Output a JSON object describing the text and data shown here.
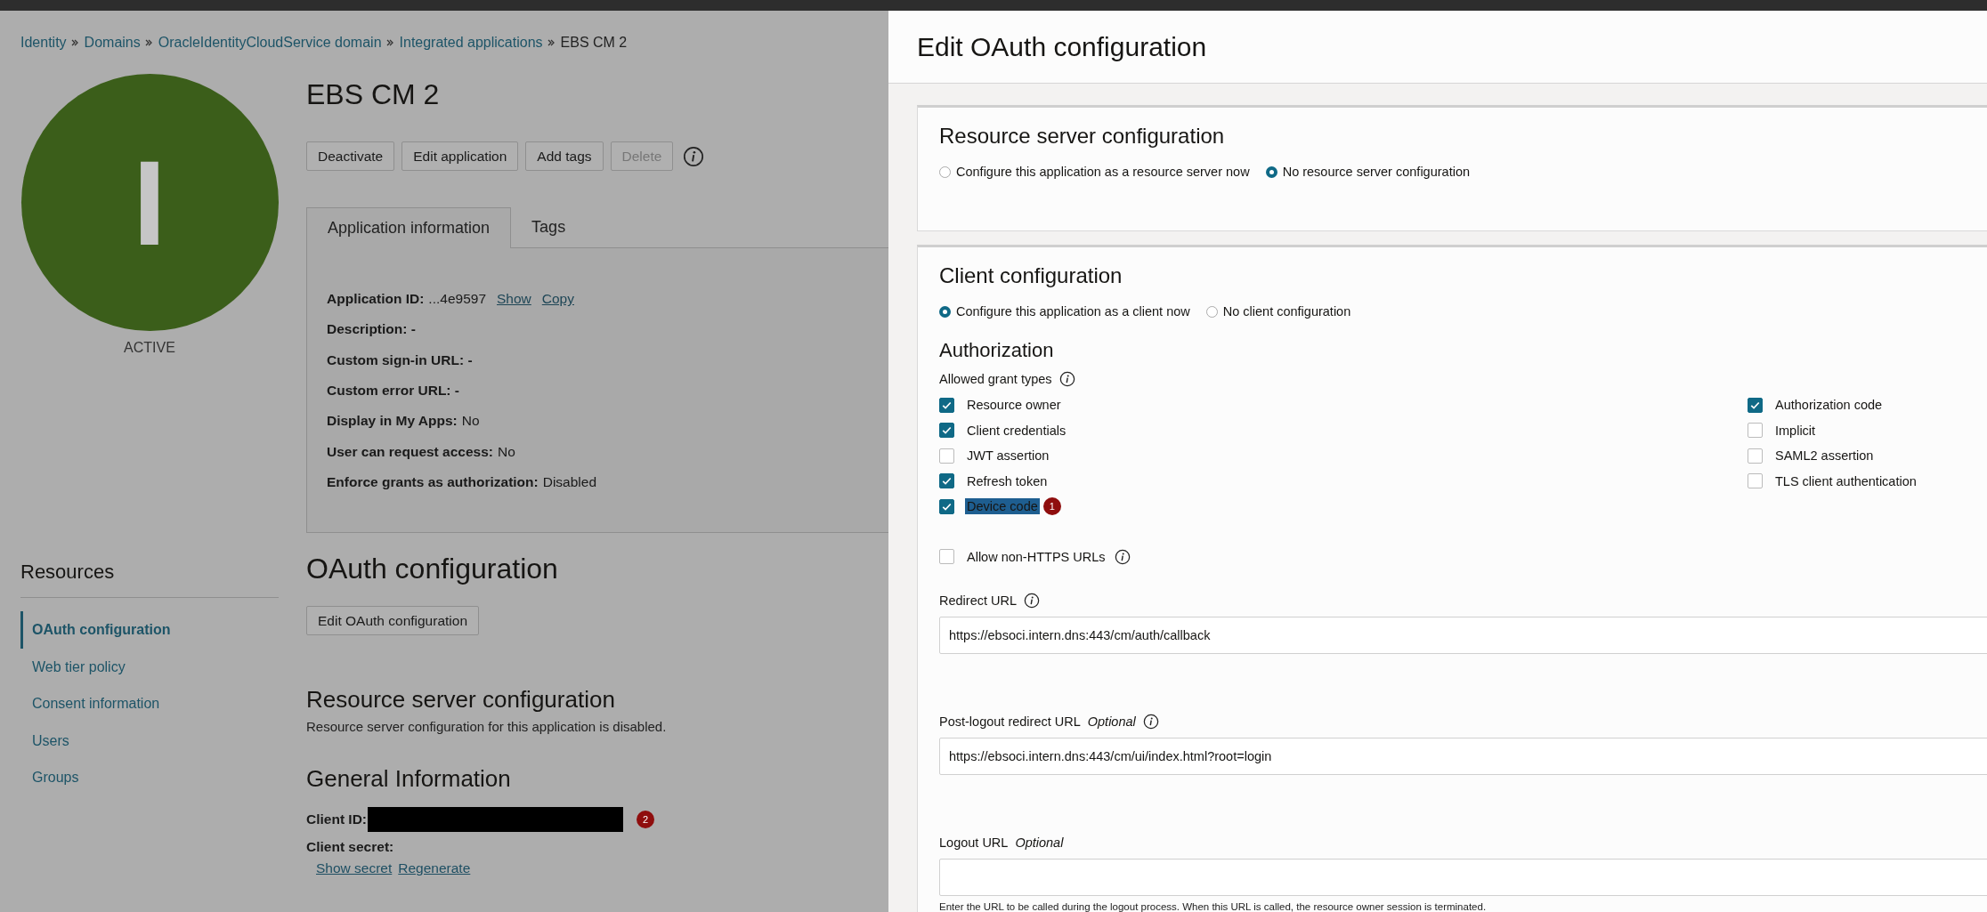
{
  "breadcrumb": [
    {
      "label": "Identity",
      "link": true
    },
    {
      "label": "Domains",
      "link": true
    },
    {
      "label": "OracleIdentityCloudService domain",
      "link": true
    },
    {
      "label": "Integrated applications",
      "link": true
    },
    {
      "label": "EBS CM 2",
      "link": false
    }
  ],
  "app": {
    "initial": "I",
    "status": "ACTIVE",
    "title": "EBS CM 2"
  },
  "actions": [
    {
      "label": "Deactivate",
      "disabled": false
    },
    {
      "label": "Edit application",
      "disabled": false
    },
    {
      "label": "Add tags",
      "disabled": false
    },
    {
      "label": "Delete",
      "disabled": true
    }
  ],
  "tabs": [
    {
      "label": "Application information",
      "selected": true
    },
    {
      "label": "Tags",
      "selected": false
    }
  ],
  "app_info": [
    {
      "label": "Application ID:",
      "value": "...4e9597",
      "links": [
        "Show",
        "Copy"
      ]
    },
    {
      "label": "Description: -"
    },
    {
      "label": "Custom sign-in URL: -"
    },
    {
      "label": "Custom error URL: -"
    },
    {
      "label": "Display in My Apps:",
      "value": "No"
    },
    {
      "label": "User can request access:",
      "value": "No"
    },
    {
      "label": "Enforce grants as authorization:",
      "value": "Disabled"
    }
  ],
  "resources": {
    "title": "Resources",
    "items": [
      {
        "label": "OAuth configuration",
        "selected": true
      },
      {
        "label": "Web tier policy",
        "selected": false
      },
      {
        "label": "Consent information",
        "selected": false
      },
      {
        "label": "Users",
        "selected": false
      },
      {
        "label": "Groups",
        "selected": false
      }
    ]
  },
  "oauth": {
    "title": "OAuth configuration",
    "edit_button": "Edit OAuth configuration",
    "resource_server": {
      "title": "Resource server configuration",
      "text": "Resource server configuration for this application is disabled."
    },
    "general": {
      "title": "General Information",
      "client_id": {
        "label": "Client ID:",
        "redacted": true,
        "badge": "2"
      },
      "client_secret": {
        "label": "Client secret:",
        "links": [
          "Show secret",
          "Regenerate"
        ]
      }
    }
  },
  "drawer": {
    "title": "Edit OAuth configuration",
    "resource_server": {
      "title": "Resource server configuration",
      "options": [
        {
          "label": "Configure this application as a resource server now",
          "selected": false
        },
        {
          "label": "No resource server configuration",
          "selected": true
        }
      ]
    },
    "client": {
      "title": "Client configuration",
      "options": [
        {
          "label": "Configure this application as a client now",
          "selected": true
        },
        {
          "label": "No client configuration",
          "selected": false
        }
      ],
      "authorization_title": "Authorization",
      "grant_types_label": "Allowed grant types",
      "grant_columns": [
        [
          {
            "label": "Resource owner",
            "checked": true,
            "highlighted": false
          },
          {
            "label": "Client credentials",
            "checked": true,
            "highlighted": false
          },
          {
            "label": "JWT assertion",
            "checked": false,
            "highlighted": false
          },
          {
            "label": "Refresh token",
            "checked": true,
            "highlighted": false
          },
          {
            "label": "Device code",
            "checked": true,
            "highlighted": true,
            "badge": "1"
          }
        ],
        [
          {
            "label": "Authorization code",
            "checked": true,
            "highlighted": false
          },
          {
            "label": "Implicit",
            "checked": false,
            "highlighted": false
          },
          {
            "label": "SAML2 assertion",
            "checked": false,
            "highlighted": false
          },
          {
            "label": "TLS client authentication",
            "checked": false,
            "highlighted": false
          }
        ]
      ],
      "allow_non_https": {
        "label": "Allow non-HTTPS URLs",
        "checked": false
      },
      "fields": [
        {
          "label": "Redirect URL",
          "info": true,
          "value": "https://ebsoci.intern.dns:443/cm/auth/callback"
        },
        {
          "label": "Post-logout redirect URL",
          "optional": "Optional",
          "info": true,
          "value": "https://ebsoci.intern.dns:443/cm/ui/index.html?root=login"
        },
        {
          "label": "Logout URL",
          "optional": "Optional",
          "info": false,
          "help": "Enter the URL to be called during the logout process. When this URL is called, the resource owner session is terminated."
        }
      ]
    }
  }
}
